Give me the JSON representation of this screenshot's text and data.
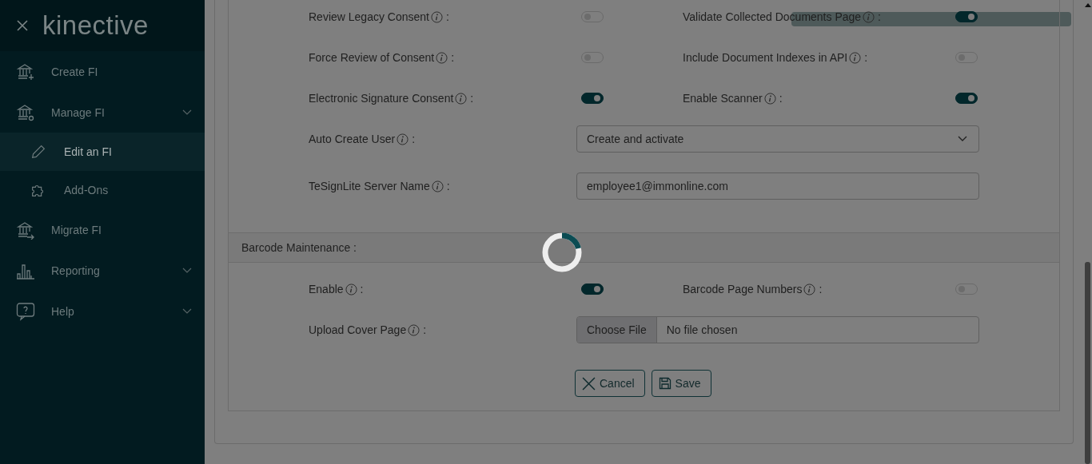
{
  "sidebar": {
    "logo": "kinective",
    "items": [
      {
        "label": "Create FI",
        "selected": false,
        "expandable": false
      },
      {
        "label": "Manage FI",
        "selected": false,
        "expandable": true,
        "children": [
          {
            "label": "Edit an FI",
            "selected": true
          },
          {
            "label": "Add-Ons",
            "selected": false
          }
        ]
      },
      {
        "label": "Migrate FI",
        "selected": false,
        "expandable": false
      },
      {
        "label": "Reporting",
        "selected": false,
        "expandable": true
      },
      {
        "label": "Help",
        "selected": false,
        "expandable": true
      }
    ]
  },
  "settings": [
    {
      "kind": "toggle_pair",
      "items": [
        {
          "label": "Review Legacy Consent",
          "separator": ":",
          "on": false
        },
        {
          "label": "Validate Collected Documents Page",
          "separator": ":",
          "on": true
        }
      ]
    },
    {
      "kind": "toggle_pair",
      "items": [
        {
          "label": "Force Review of Consent",
          "separator": ":",
          "on": false
        },
        {
          "label": "Include Document Indexes in API",
          "separator": ":",
          "on": false
        }
      ]
    },
    {
      "kind": "toggle_pair",
      "items": [
        {
          "label": "Electronic Signature Consent",
          "separator": ":",
          "on": true
        },
        {
          "label": "Enable Scanner",
          "separator": ":",
          "on": true
        }
      ]
    },
    {
      "kind": "select",
      "label": "Auto Create User",
      "separator": ":",
      "value": "Create and activate"
    },
    {
      "kind": "text",
      "label": "TeSignLite Server Name",
      "separator": ":",
      "value": "employee1@immonline.com"
    }
  ],
  "barcode_section": {
    "title": "Barcode Maintenance :",
    "rows": [
      {
        "kind": "toggle_pair",
        "items": [
          {
            "label": "Enable",
            "separator": ":",
            "on": true
          },
          {
            "label": "Barcode Page Numbers",
            "separator": ":",
            "on": false
          }
        ]
      },
      {
        "kind": "file",
        "label": "Upload Cover Page",
        "separator": ":",
        "button": "Choose File",
        "value": "No file chosen"
      }
    ]
  },
  "buttons": [
    {
      "kind": "cancel",
      "label": "Cancel"
    },
    {
      "kind": "save",
      "label": "Save"
    }
  ]
}
